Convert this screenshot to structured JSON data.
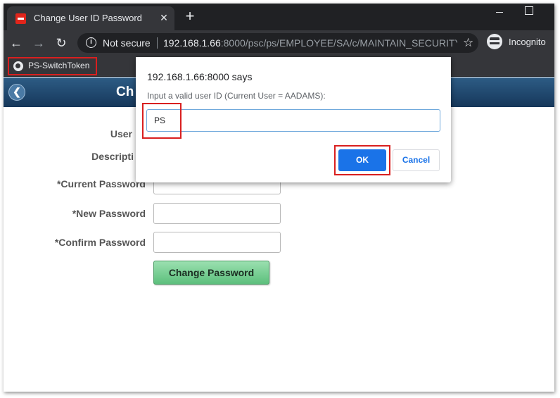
{
  "browser": {
    "tab_title": "Change User ID Password",
    "tab_close": "✕",
    "new_tab": "+",
    "not_secure": "Not secure",
    "url_host": "192.168.1.66",
    "url_rest": ":8000/psc/ps/EMPLOYEE/SA/c/MAINTAIN_SECURITY....",
    "incognito": "Incognito",
    "bookmark": "PS-SwitchToken"
  },
  "page": {
    "title": "Ch",
    "labels": {
      "user_id": "User",
      "description": "Descripti",
      "current_password": "*Current Password",
      "new_password": "*New Password",
      "confirm_password": "*Confirm Password"
    },
    "change_password_button": "Change Password"
  },
  "dialog": {
    "title": "192.168.1.66:8000 says",
    "message": "Input a valid user ID (Current User = AADAMS):",
    "input_value": "PS",
    "ok": "OK",
    "cancel": "Cancel"
  },
  "colors": {
    "highlight": "#d91f1f",
    "ok_button": "#1a73e8",
    "header_blue": "#16375a",
    "change_button_green": "#5cbf7c"
  }
}
